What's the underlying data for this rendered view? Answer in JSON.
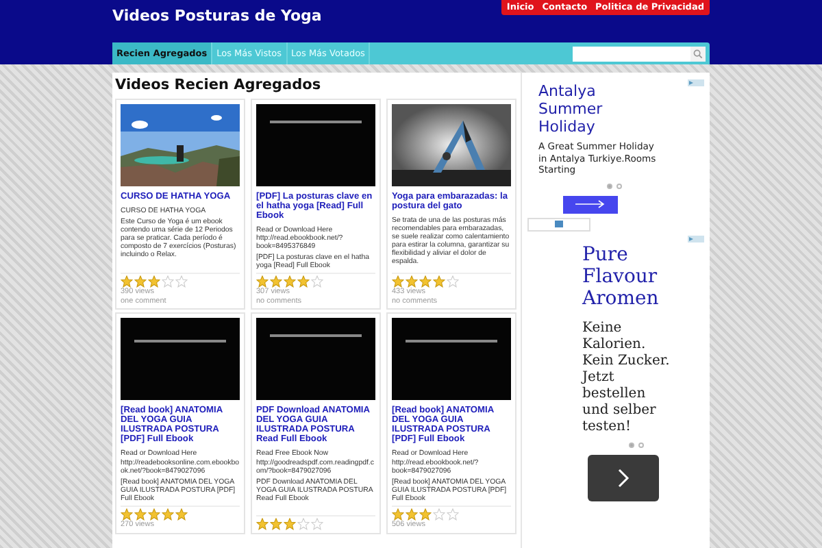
{
  "site": {
    "title": "Videos Posturas de Yoga"
  },
  "top_links": [
    {
      "label": "Inicio"
    },
    {
      "label": "Contacto"
    },
    {
      "label": "Politica de Privacidad"
    }
  ],
  "nav_tabs": [
    {
      "label": "Recien Agregados",
      "selected": true
    },
    {
      "label": "Los Más Vistos",
      "selected": false
    },
    {
      "label": "Los Más Votados",
      "selected": false
    }
  ],
  "section_title": "Videos Recien Agregados",
  "videos": [
    {
      "title": "CURSO DE HATHA YOGA",
      "paragraphs": [
        "CURSO DE HATHA YOGA",
        "Este Curso de Yoga é um ebook contendo uma série de 12 Periodos para se praticar. Cada período é composto de 7 exercícios (Posturas) incluindo o Relax."
      ],
      "stars": 3,
      "views": "390 views",
      "comments": "one comment"
    },
    {
      "title": "[PDF] La posturas clave en el hatha yoga [Read] Full Ebook",
      "paragraphs": [
        "Read or Download Here http://read.ebookbook.net/?book=8495376849",
        "[PDF] La posturas clave en el hatha yoga [Read] Full Ebook"
      ],
      "stars": 4,
      "views": "307 views",
      "comments": "no comments"
    },
    {
      "title": "Yoga para embarazadas: la postura del gato",
      "paragraphs": [
        "Se trata de una de las posturas más recomendables para embarazadas, se suele realizar como calentamiento para estirar la columna, garantizar su flexibilidad y aliviar el dolor de espalda."
      ],
      "stars": 4,
      "views": "433 views",
      "comments": "no comments"
    },
    {
      "title": "[Read book] ANATOMIA DEL YOGA GUIA ILUSTRADA POSTURA [PDF] Full Ebook",
      "paragraphs": [
        "Read or Download Here http://readebooksonline.com.ebookbook.net/?book=8479027096",
        "[Read book] ANATOMIA DEL YOGA GUIA ILUSTRADA POSTURA [PDF] Full Ebook"
      ],
      "stars": 5,
      "views": "270 views"
    },
    {
      "title": "PDF Download ANATOMIA DEL YOGA GUIA ILUSTRADA POSTURA Read Full Ebook",
      "paragraphs": [
        "Read Free Ebook Now http://goodreadspdf.com.readingpdf.com/?book=8479027096",
        "PDF Download ANATOMIA DEL YOGA GUIA ILUSTRADA POSTURA Read Full Ebook"
      ],
      "stars": 3
    },
    {
      "title": "[Read book] ANATOMIA DEL YOGA GUIA ILUSTRADA POSTURA [PDF] Full Ebook",
      "paragraphs": [
        "Read or Download Here http://read.ebookbook.net/?book=8479027096",
        "[Read book] ANATOMIA DEL YOGA GUIA ILUSTRADA POSTURA [PDF] Full Ebook"
      ],
      "stars": 3,
      "views": "506 views"
    }
  ],
  "ads": [
    {
      "kind": "sans",
      "title": "Antalya Summer Holiday",
      "text": "A Great Summer Holiday in Antalya Turkiye.Rooms Starting",
      "pages": [
        {
          "selected": true
        },
        {
          "selected": false
        }
      ]
    },
    {
      "kind": "serif",
      "title": "Pure Flavour Aromen",
      "text": "Keine Kalorien. Kein Zucker. Jetzt bestellen und selber testen!",
      "pages": [
        {
          "selected": true
        },
        {
          "selected": false
        }
      ]
    }
  ]
}
